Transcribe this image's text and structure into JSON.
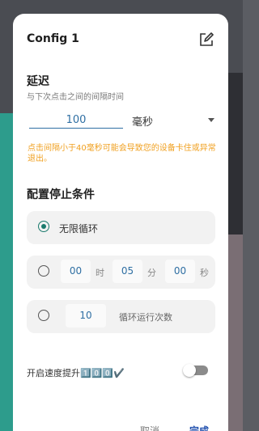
{
  "dialog": {
    "title": "Config 1",
    "delay": {
      "heading": "延迟",
      "subtitle": "与下次点击之间的间隔时间",
      "value": "100",
      "unit": "毫秒",
      "warning": "点击间隔小于40毫秒可能会导致您的设备卡住或异常退出。"
    },
    "stop": {
      "heading": "配置停止条件",
      "option_infinite": "无限循环",
      "timer": {
        "hours": "00",
        "hours_unit": "时",
        "minutes": "05",
        "minutes_unit": "分",
        "seconds": "00",
        "seconds_unit": "秒"
      },
      "cycles": {
        "value": "10",
        "label": "循环运行次数"
      }
    },
    "speed_boost": {
      "label": "开启速度提升",
      "badge": "1️⃣0️⃣0️⃣✔️",
      "enabled": false
    },
    "buttons": {
      "cancel": "取消",
      "done": "完成"
    }
  },
  "colors": {
    "accent": "#1a7a6c",
    "link": "#2f6fa3",
    "warning": "#f0a020",
    "primary_button": "#1f4fae"
  }
}
